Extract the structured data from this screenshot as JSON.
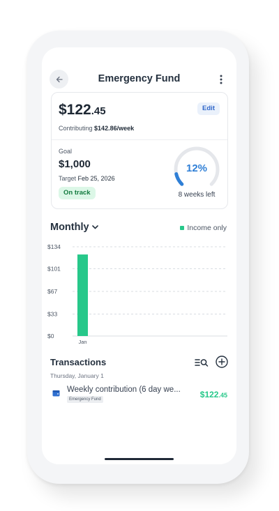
{
  "header": {
    "title": "Emergency Fund"
  },
  "summary": {
    "balance_main": "$122",
    "balance_cents": ".45",
    "edit_label": "Edit",
    "contrib_prefix": "Contributing",
    "contrib_value": "$142.86/week"
  },
  "goal": {
    "label": "Goal",
    "amount": "$1,000",
    "target_prefix": "Target",
    "target_date": "Feb 25, 2026",
    "status": "On track",
    "progress_label": "12%",
    "progress": 0.12,
    "weeks_left": "8 weeks left"
  },
  "chart_controls": {
    "period": "Monthly",
    "legend": "Income only"
  },
  "chart_data": {
    "type": "bar",
    "categories": [
      "Jan"
    ],
    "values": [
      122.45
    ],
    "yticks": [
      "$134",
      "$101",
      "$67",
      "$33",
      "$0"
    ],
    "ytick_values": [
      134,
      101,
      67,
      33,
      0
    ],
    "ylim": [
      0,
      134
    ],
    "grid": true,
    "color": "#27c88a"
  },
  "transactions": {
    "title": "Transactions",
    "date": "Thursday, January 1",
    "items": [
      {
        "name": "Weekly contribution (6 day we...",
        "tag": "Emergency Fund",
        "amount_main": "$122",
        "amount_cents": ".45"
      }
    ]
  },
  "colors": {
    "accent_green": "#27c88a",
    "accent_blue": "#2f7fd6",
    "edit_blue": "#2f66c9",
    "status_green_bg": "#dcf7e7"
  },
  "icons": {
    "back": "arrow-left-icon",
    "more": "more-vertical-icon",
    "chevron": "chevron-down-icon",
    "filter": "filter-search-icon",
    "add": "plus-circle-icon",
    "wallet": "wallet-icon"
  }
}
